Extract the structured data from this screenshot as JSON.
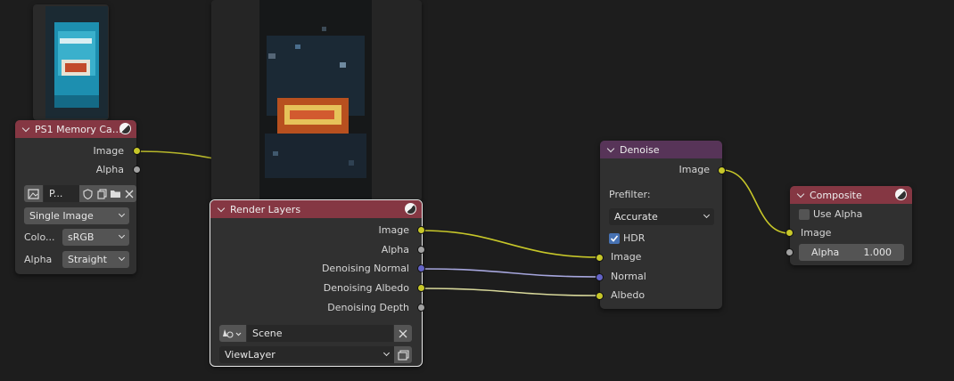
{
  "image_node": {
    "title": "PS1 Memory Car...",
    "outputs": [
      "Image",
      "Alpha"
    ],
    "datablock_name": "P...",
    "source": "Single Image",
    "colorspace_label": "Colo...",
    "colorspace_value": "sRGB",
    "alpha_label": "Alpha",
    "alpha_value": "Straight",
    "icons": [
      "image-icon",
      "fake-user-shield-icon",
      "duplicate-icon",
      "open-folder-icon",
      "close-icon"
    ]
  },
  "render_layers": {
    "title": "Render Layers",
    "outputs": [
      "Image",
      "Alpha",
      "Denoising Normal",
      "Denoising Albedo",
      "Denoising Depth"
    ],
    "scene": "Scene",
    "view_layer": "ViewLayer"
  },
  "denoise": {
    "title": "Denoise",
    "output": "Image",
    "prefilter_label": "Prefilter:",
    "prefilter_value": "Accurate",
    "hdr_label": "HDR",
    "hdr_checked": true,
    "inputs": [
      "Image",
      "Normal",
      "Albedo"
    ]
  },
  "composite": {
    "title": "Composite",
    "use_alpha_label": "Use Alpha",
    "use_alpha_checked": false,
    "input": "Image",
    "alpha_label": "Alpha",
    "alpha_value": "1.000"
  },
  "colors": {
    "background": "#1d1d1d",
    "node_body": "#303030",
    "input_header": "#853743",
    "filter_header": "#573458",
    "socket_color": "#c7c729",
    "socket_float": "#a1a1a1",
    "socket_vector": "#6363c7",
    "checkbox_accent": "#4772b3"
  }
}
